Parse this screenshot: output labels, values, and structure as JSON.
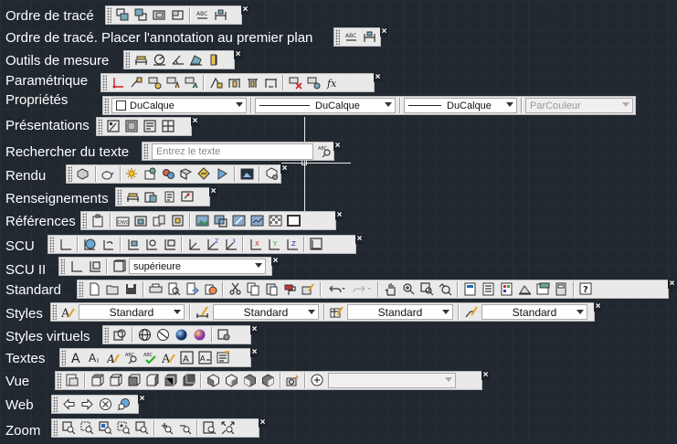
{
  "toolbars": {
    "ordre_trace": {
      "label": "Ordre de tracé"
    },
    "ordre_annotation": {
      "label": "Ordre de tracé. Placer l'annotation au premier plan"
    },
    "outils_mesure": {
      "label": "Outils de mesure"
    },
    "parametrique": {
      "label": "Paramétrique"
    },
    "proprietes": {
      "label": "Propriétés",
      "color_value": "DuCalque",
      "linetype_value": "DuCalque",
      "lineweight_value": "DuCalque",
      "plotstyle_value": "ParCouleur"
    },
    "presentations": {
      "label": "Présentations"
    },
    "rechercher": {
      "label": "Rechercher du texte",
      "placeholder": "Entrez le texte"
    },
    "rendu": {
      "label": "Rendu"
    },
    "renseignements": {
      "label": "Renseignements"
    },
    "references": {
      "label": "Références"
    },
    "scu": {
      "label": "SCU"
    },
    "scu2": {
      "label": "SCU II",
      "view_value": "supérieure"
    },
    "standard": {
      "label": "Standard"
    },
    "styles": {
      "label": "Styles",
      "text_style": "Standard",
      "dim_style": "Standard",
      "table_style": "Standard",
      "mleader_style": "Standard"
    },
    "styles_virtuels": {
      "label": "Styles virtuels"
    },
    "textes": {
      "label": "Textes"
    },
    "vue": {
      "label": "Vue"
    },
    "web": {
      "label": "Web"
    },
    "zoom": {
      "label": "Zoom"
    }
  },
  "close_glyph": "×"
}
